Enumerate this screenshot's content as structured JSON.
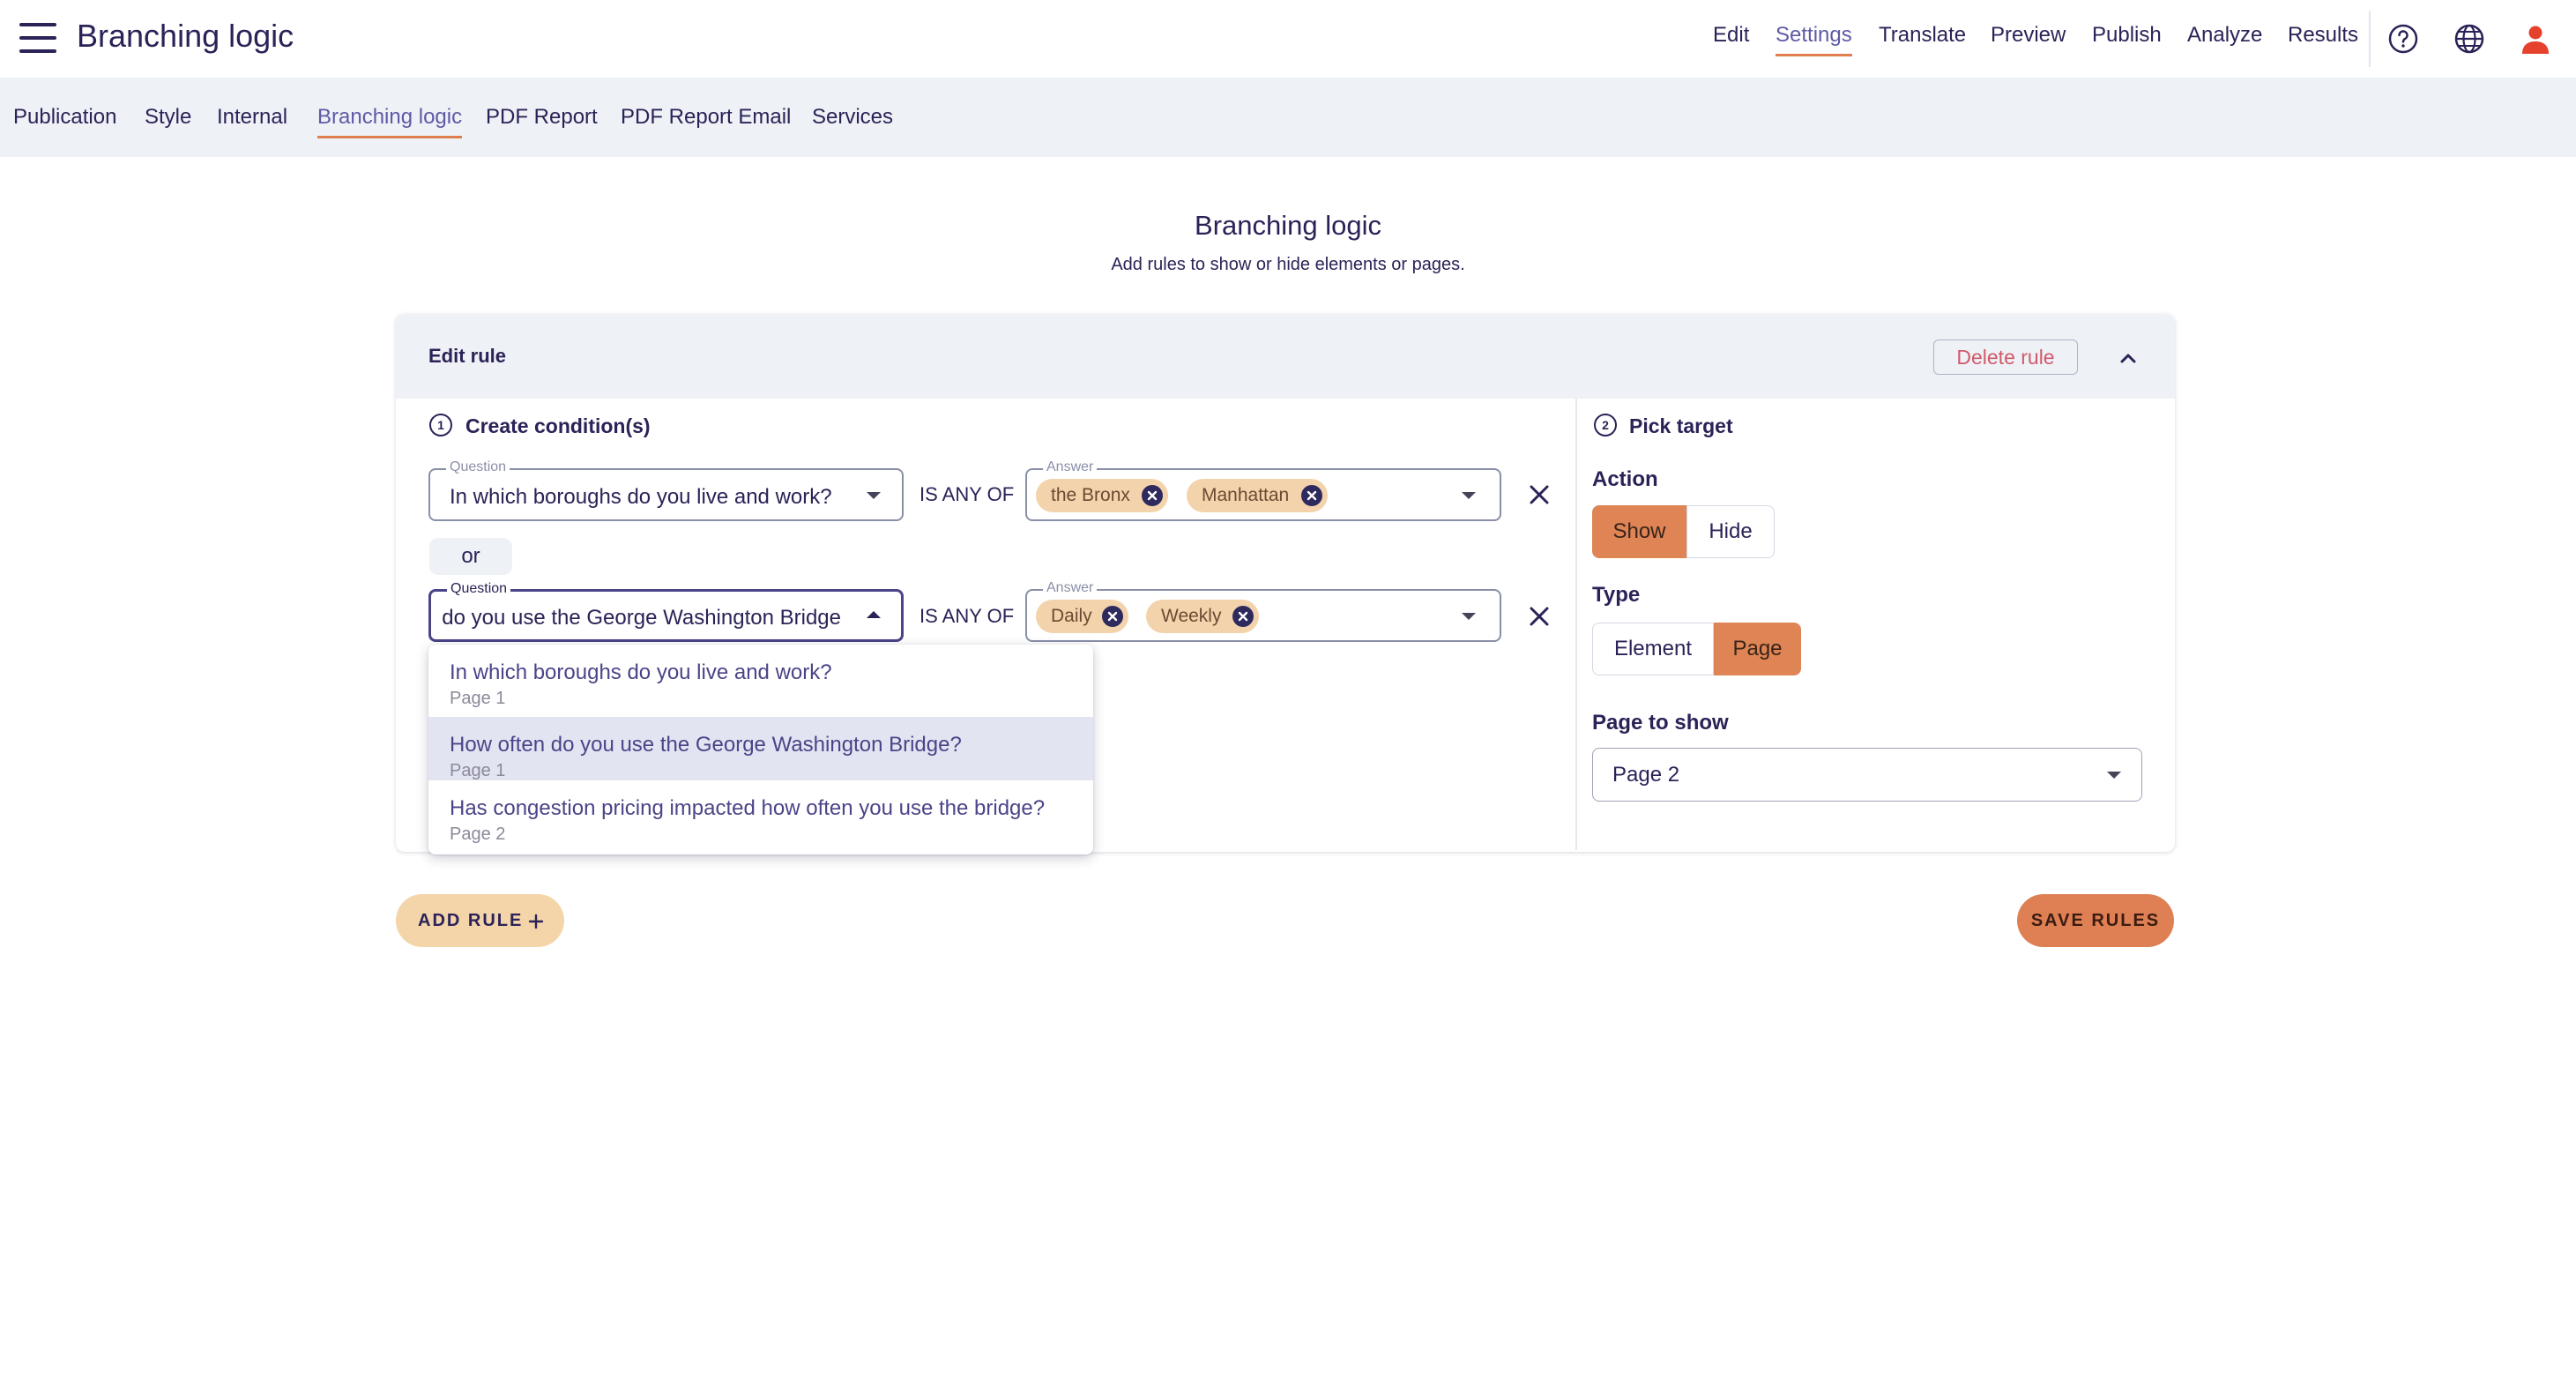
{
  "app": {
    "title": "Branching logic"
  },
  "topnav": [
    "Edit",
    "Settings",
    "Translate",
    "Preview",
    "Publish",
    "Analyze",
    "Results"
  ],
  "topnav_active": "Settings",
  "topnav_icons": [
    "help-icon",
    "globe-icon",
    "user-icon"
  ],
  "subnav": [
    "Publication",
    "Style",
    "Internal",
    "Branching logic",
    "PDF Report",
    "PDF Report Email",
    "Services"
  ],
  "subnav_active": "Branching logic",
  "page": {
    "title": "Branching logic",
    "subtitle": "Add rules to show or hide elements or pages."
  },
  "rule": {
    "header": "Edit rule",
    "delete_label": "Delete rule",
    "conditions": {
      "step": "1",
      "title": "Create condition(s)",
      "question_label": "Question",
      "answer_label": "Answer",
      "operator": "IS ANY OF",
      "or_label": "or",
      "rows": [
        {
          "question": "In which boroughs do you live and work?",
          "answers": [
            "the Bronx",
            "Manhattan"
          ]
        },
        {
          "question": "How often do you use the George Washington Bridge?",
          "answers": [
            "Daily",
            "Weekly"
          ]
        }
      ]
    },
    "dropdown": {
      "options": [
        {
          "question": "In which boroughs do you live and work?",
          "page": "Page 1",
          "selected": false
        },
        {
          "question": "How often do you use the George Washington Bridge?",
          "page": "Page 1",
          "selected": true
        },
        {
          "question": "Has congestion pricing impacted how often you use the bridge?",
          "page": "Page 2",
          "selected": false
        }
      ]
    },
    "target": {
      "step": "2",
      "title": "Pick target",
      "action_label": "Action",
      "action_options": [
        "Show",
        "Hide"
      ],
      "action_selected": "Show",
      "type_label": "Type",
      "type_options": [
        "Element",
        "Page"
      ],
      "type_selected": "Page",
      "page_label": "Page to show",
      "page_value": "Page 2"
    }
  },
  "buttons": {
    "add_rule": "ADD RULE",
    "save_rules": "SAVE RULES"
  },
  "colors": {
    "accent": "#de8455",
    "navy": "#2b2257",
    "chip": "#f3d3ab",
    "add_button": "#f4d4a9",
    "danger": "#d05a6a"
  }
}
